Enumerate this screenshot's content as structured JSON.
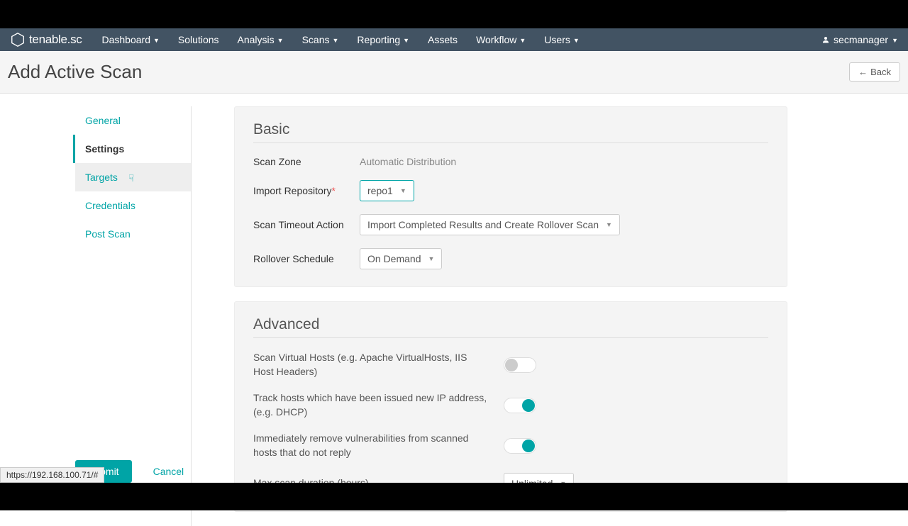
{
  "brand": "tenable.sc",
  "nav": {
    "items": [
      "Dashboard",
      "Solutions",
      "Analysis",
      "Scans",
      "Reporting",
      "Assets",
      "Workflow",
      "Users"
    ],
    "has_dropdown": [
      true,
      false,
      true,
      true,
      true,
      false,
      true,
      true
    ],
    "user": "secmanager"
  },
  "page": {
    "title": "Add Active Scan",
    "back": "Back"
  },
  "sidebar": {
    "items": [
      "General",
      "Settings",
      "Targets",
      "Credentials",
      "Post Scan"
    ],
    "active_index": 1,
    "hover_index": 2
  },
  "basic": {
    "title": "Basic",
    "scan_zone_label": "Scan Zone",
    "scan_zone_value": "Automatic Distribution",
    "import_repo_label": "Import Repository",
    "import_repo_value": "repo1",
    "timeout_label": "Scan Timeout Action",
    "timeout_value": "Import Completed Results and Create Rollover Scan",
    "rollover_label": "Rollover Schedule",
    "rollover_value": "On Demand"
  },
  "advanced": {
    "title": "Advanced",
    "virtual_label": "Scan Virtual Hosts (e.g. Apache VirtualHosts, IIS Host Headers)",
    "virtual_on": false,
    "track_label": "Track hosts which have been issued new IP address, (e.g. DHCP)",
    "track_on": true,
    "remove_label": "Immediately remove vulnerabilities from scanned hosts that do not reply",
    "remove_on": true,
    "max_label": "Max scan duration (hours)",
    "max_value": "Unlimited"
  },
  "actions": {
    "submit": "Submit",
    "cancel": "Cancel"
  },
  "status_url": "https://192.168.100.71/#"
}
